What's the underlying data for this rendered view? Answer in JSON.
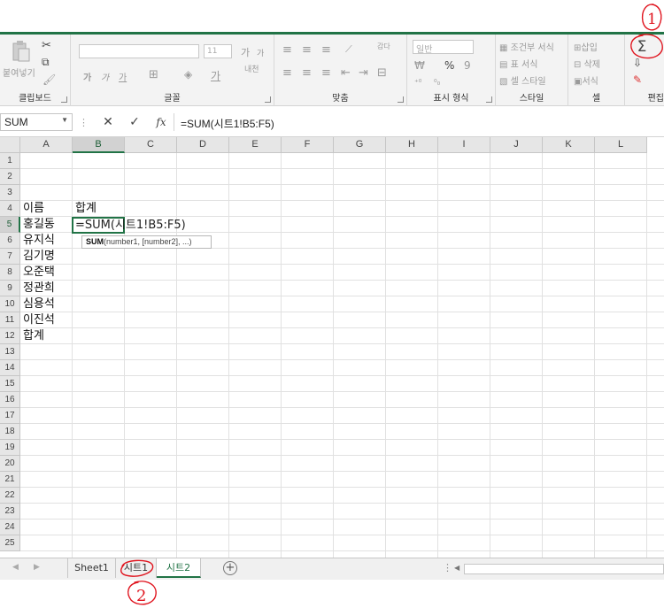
{
  "ribbon": {
    "clipboard": {
      "paste_label": "붙여넣기",
      "group_label": "클립보드"
    },
    "font": {
      "group_label": "글꼴",
      "size_value": "11",
      "bold": "가",
      "italic": "가",
      "underline": "가",
      "grow": "가",
      "shrink": "가",
      "phonetic": "내천"
    },
    "alignment": {
      "group_label": "맞춤",
      "wrap": "감다"
    },
    "number": {
      "group_label": "표시 형식",
      "format_value": "일반",
      "percent": "%",
      "comma": "9"
    },
    "styles": {
      "group_label": "스타일",
      "conditional": "조건부 서식",
      "table": "표 서식",
      "cell_style": "셀 스타일"
    },
    "cells": {
      "group_label": "셀",
      "insert": "삽입",
      "delete": "삭제",
      "format": "서식"
    },
    "editing": {
      "group_label": "편집",
      "autosum": "Σ"
    }
  },
  "formula_bar": {
    "name_box": "SUM",
    "cancel": "✕",
    "enter": "✓",
    "fx": "fx",
    "formula": "=SUM(시트1!B5:F5)"
  },
  "columns": [
    "A",
    "B",
    "C",
    "D",
    "E",
    "F",
    "G",
    "H",
    "I",
    "J",
    "K",
    "L"
  ],
  "rows": [
    "1",
    "2",
    "3",
    "4",
    "5",
    "6",
    "7",
    "8",
    "9",
    "10",
    "11",
    "12",
    "13",
    "14",
    "15",
    "16",
    "17",
    "18",
    "19",
    "20",
    "21",
    "22",
    "23",
    "24",
    "25"
  ],
  "cells": {
    "A4": "이름",
    "B4": "합계",
    "A5": "홍길동",
    "A6": "유지식",
    "A7": "김기명",
    "A8": "오준택",
    "A9": "정관희",
    "A10": "심용석",
    "A11": "이진석",
    "A12": "합계"
  },
  "active_cell": {
    "prefix": "=SUM",
    "rest": "(시트1!B5:F5)"
  },
  "tooltip": {
    "func": "SUM",
    "args": "(number1, [number2], ...)"
  },
  "sheet_tabs": [
    {
      "label": "Sheet1",
      "active": false
    },
    {
      "label": "시트1",
      "active": false
    },
    {
      "label": "시트2",
      "active": true
    }
  ],
  "scroll_dots": "⋮",
  "annotations": {
    "one": "1",
    "two": "2"
  },
  "colors": {
    "excel_green": "#217346",
    "annotation_red": "#e0141e"
  }
}
